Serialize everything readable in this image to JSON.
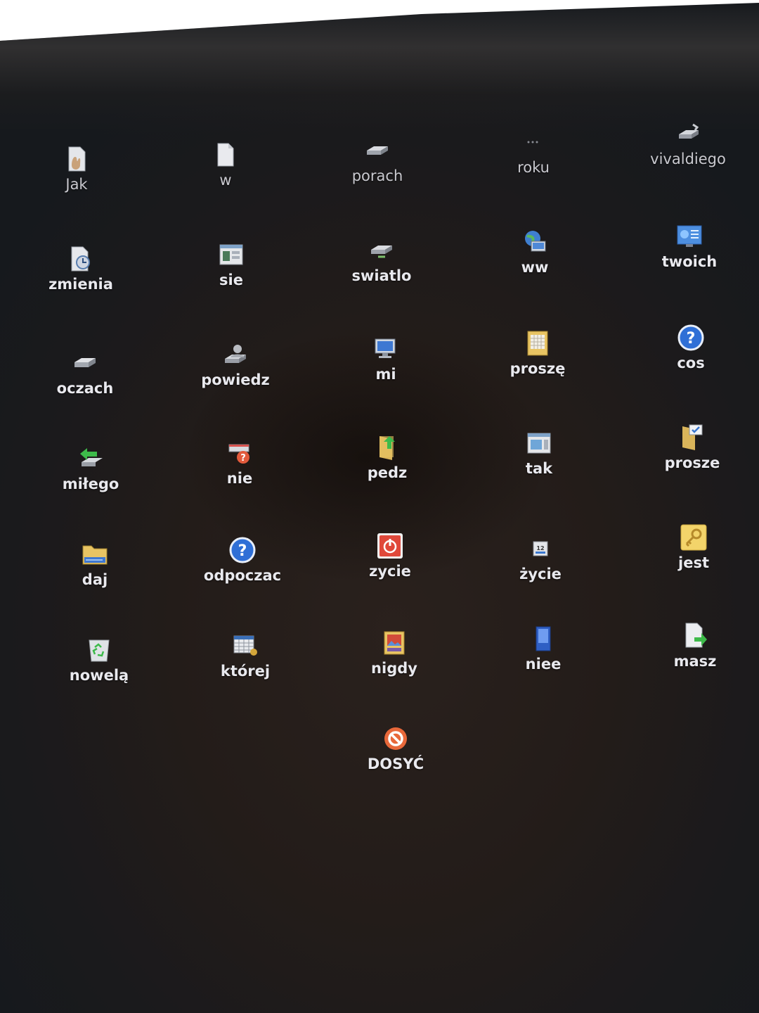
{
  "desktop": {
    "icons": [
      {
        "label": "Jak",
        "icon": "hand-document-icon"
      },
      {
        "label": "w",
        "icon": "blank-document-icon"
      },
      {
        "label": "porach",
        "icon": "drive-icon"
      },
      {
        "label": "roku",
        "icon": "small-dots-icon"
      },
      {
        "label": "vivaldiego",
        "icon": "network-drive-icon"
      },
      {
        "label": "zmienia",
        "icon": "clock-document-icon"
      },
      {
        "label": "sie",
        "icon": "window-icon"
      },
      {
        "label": "swiatlo",
        "icon": "network-drive-icon"
      },
      {
        "label": "ww",
        "icon": "network-globe-icon"
      },
      {
        "label": "twoich",
        "icon": "control-panel-icon"
      },
      {
        "label": "oczach",
        "icon": "drive-icon"
      },
      {
        "label": "powiedz",
        "icon": "user-cd-icon"
      },
      {
        "label": "mi",
        "icon": "computer-icon"
      },
      {
        "label": "proszę",
        "icon": "calendar-icon"
      },
      {
        "label": "cos",
        "icon": "help-icon"
      },
      {
        "label": "miłego",
        "icon": "green-arrow-icon"
      },
      {
        "label": "nie",
        "icon": "drive-error-icon"
      },
      {
        "label": "pedz",
        "icon": "folder-arrow-icon"
      },
      {
        "label": "tak",
        "icon": "window-icon"
      },
      {
        "label": "prosze",
        "icon": "folder-check-icon"
      },
      {
        "label": "daj",
        "icon": "folder-icon"
      },
      {
        "label": "odpoczac",
        "icon": "help-icon"
      },
      {
        "label": "zycie",
        "icon": "power-icon"
      },
      {
        "label": "życie",
        "icon": "badge-icon"
      },
      {
        "label": "jest",
        "icon": "key-icon"
      },
      {
        "label": "nowelą",
        "icon": "recycle-bin-icon"
      },
      {
        "label": "której",
        "icon": "spreadsheet-icon"
      },
      {
        "label": "nigdy",
        "icon": "picture-icon"
      },
      {
        "label": "niee",
        "icon": "blue-card-icon"
      },
      {
        "label": "masz",
        "icon": "document-arrow-icon"
      },
      {
        "label": "DOSYĆ",
        "icon": "stop-icon"
      }
    ]
  },
  "colors": {
    "label": "#e9e9ee",
    "help_blue": "#2f6fd6",
    "stop_orange": "#e8683a",
    "folder_yellow": "#e8c463"
  }
}
